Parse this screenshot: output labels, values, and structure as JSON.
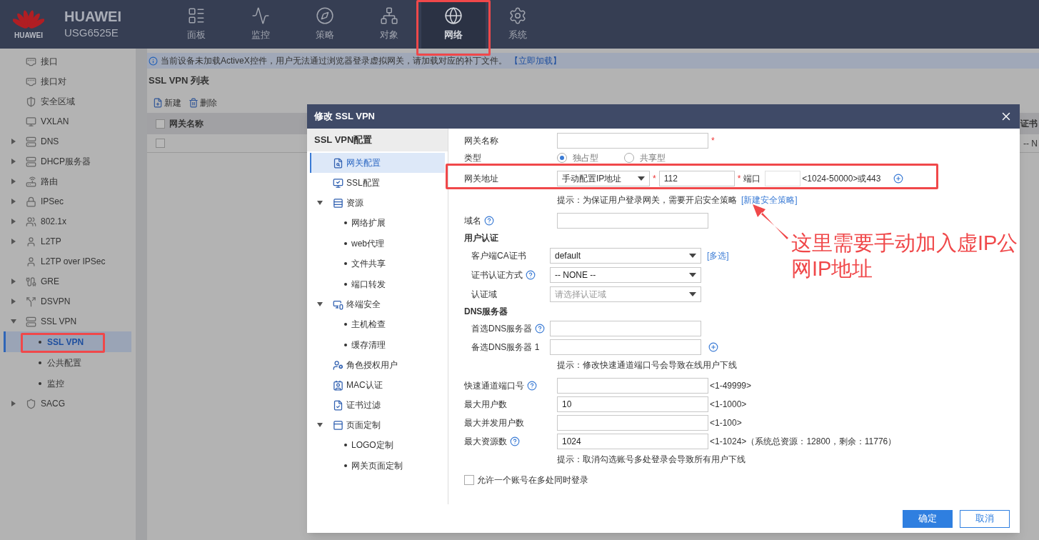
{
  "header": {
    "logo_text": "HUAWEI",
    "brand": "HUAWEI",
    "model": "USG6525E"
  },
  "nav": [
    {
      "label": "面板",
      "selected": false
    },
    {
      "label": "监控",
      "selected": false
    },
    {
      "label": "策略",
      "selected": false
    },
    {
      "label": "对象",
      "selected": false
    },
    {
      "label": "网络",
      "selected": true
    },
    {
      "label": "系统",
      "selected": false
    }
  ],
  "sidebar": [
    {
      "kind": "leaf",
      "label": "接口"
    },
    {
      "kind": "leaf",
      "label": "接口对"
    },
    {
      "kind": "leaf",
      "label": "安全区域"
    },
    {
      "kind": "leaf",
      "label": "VXLAN"
    },
    {
      "kind": "folder",
      "label": "DNS",
      "expanded": false
    },
    {
      "kind": "folder",
      "label": "DHCP服务器",
      "expanded": false
    },
    {
      "kind": "folder",
      "label": "路由",
      "expanded": false
    },
    {
      "kind": "folder",
      "label": "IPSec",
      "expanded": false
    },
    {
      "kind": "folder",
      "label": "802.1x",
      "expanded": false
    },
    {
      "kind": "folder",
      "label": "L2TP",
      "expanded": false
    },
    {
      "kind": "leaf",
      "label": "L2TP over IPSec"
    },
    {
      "kind": "folder",
      "label": "GRE",
      "expanded": false
    },
    {
      "kind": "folder",
      "label": "DSVPN",
      "expanded": false
    },
    {
      "kind": "folder",
      "label": "SSL VPN",
      "expanded": true,
      "children": [
        {
          "label": "SSL VPN",
          "selected": true
        },
        {
          "label": "公共配置",
          "selected": false
        },
        {
          "label": "监控",
          "selected": false
        }
      ]
    },
    {
      "kind": "folder",
      "label": "SACG",
      "expanded": false
    }
  ],
  "notice": {
    "text": "当前设备未加载ActiveX控件，用户无法通过浏览器登录虚拟网关，请加载对应的补丁文件。",
    "link": "【立即加载】"
  },
  "list": {
    "title": "SSL VPN 列表",
    "toolbar": [
      "新建",
      "删除"
    ],
    "columns": [
      "网关名称",
      "证书"
    ],
    "header_checked": false,
    "row": {
      "checked": false,
      "column_2": "-- N"
    }
  },
  "dialog": {
    "title": "修改 SSL VPN",
    "nav_title": "SSL VPN配置",
    "nav": [
      {
        "label": "网关配置",
        "selected": true
      },
      {
        "label": "SSL配置",
        "selected": false
      },
      {
        "label": "资源",
        "selected": false,
        "expanded": true,
        "children": [
          {
            "label": "网络扩展",
            "selected": false
          },
          {
            "label": "web代理",
            "selected": false
          },
          {
            "label": "文件共享",
            "selected": false
          },
          {
            "label": "端口转发",
            "selected": false
          }
        ]
      },
      {
        "label": "终端安全",
        "selected": false,
        "expanded": true,
        "children": [
          {
            "label": "主机检查",
            "selected": false
          },
          {
            "label": "缓存清理",
            "selected": false
          }
        ]
      },
      {
        "label": "角色授权用户",
        "selected": false
      },
      {
        "label": "MAC认证",
        "selected": false
      },
      {
        "label": "证书过滤",
        "selected": false
      },
      {
        "label": "页面定制",
        "selected": false,
        "expanded": true,
        "children": [
          {
            "label": "LOGO定制",
            "selected": false
          },
          {
            "label": "网关页面定制",
            "selected": false
          }
        ]
      }
    ],
    "form": [
      {
        "kind": "input",
        "label": "网关名称",
        "required": "*"
      },
      {
        "kind": "radio",
        "label": "类型",
        "options": [
          {
            "label": "独占型",
            "selected": true
          },
          {
            "label": "共享型",
            "selected": false
          }
        ]
      },
      {
        "kind": "address",
        "label": "网关地址",
        "mode": "手动配置IP地址",
        "ip_mark": "*",
        "ip": "112",
        "port_mark": "*",
        "port_label": "端口",
        "range": "<1024-50000>或443"
      },
      {
        "kind": "hint",
        "text": "提示：为保证用户登录网关，需要开启安全策略",
        "link": "[新建安全策略]"
      },
      {
        "kind": "input",
        "label": "域名",
        "help": true
      },
      {
        "kind": "section",
        "label": "用户认证",
        "children": [
          {
            "kind": "select",
            "label": "客户端CA证书",
            "value": "default",
            "link": "[多选]"
          },
          {
            "kind": "select",
            "label": "证书认证方式",
            "value": "-- NONE --",
            "help": true
          },
          {
            "kind": "select",
            "label": "认证域",
            "placeholder": "请选择认证域"
          }
        ]
      },
      {
        "kind": "section",
        "label": "DNS服务器",
        "children": [
          {
            "kind": "input",
            "label": "首选DNS服务器",
            "help": true
          },
          {
            "kind": "input",
            "label": "备选DNS服务器 1",
            "add": true
          }
        ]
      },
      {
        "kind": "hint",
        "text": "提示：修改快速通道端口号会导致在线用户下线"
      },
      {
        "kind": "input",
        "label": "快速通道端口号",
        "help": true,
        "range": "<1-49999>"
      },
      {
        "kind": "input",
        "label": "最大用户数",
        "value": "10",
        "range": "<1-1000>"
      },
      {
        "kind": "input",
        "label": "最大并发用户数",
        "range": "<1-100>"
      },
      {
        "kind": "input",
        "label": "最大资源数",
        "value": "1024",
        "help": true,
        "range": "<1-1024>（系统总资源：12800，剩余：11776）"
      },
      {
        "kind": "hint",
        "text": "提示：取消勾选账号多处登录会导致所有用户下线"
      },
      {
        "kind": "checkbox",
        "label": "允许一个账号在多处同时登录",
        "checked": false
      }
    ],
    "buttons": [
      {
        "label": "确定",
        "kind": "primary"
      },
      {
        "label": "取消",
        "kind": "secondary"
      }
    ]
  },
  "annotation": {
    "lines": [
      "这里需要手动加入虚IP公",
      "网IP地址"
    ]
  }
}
